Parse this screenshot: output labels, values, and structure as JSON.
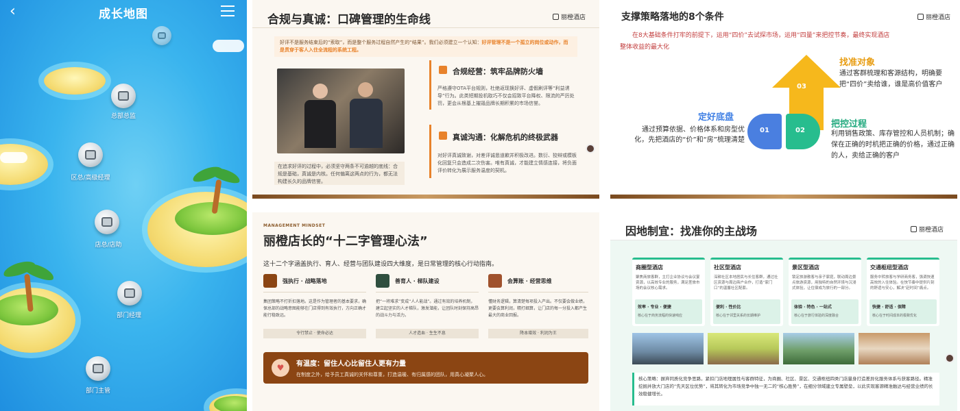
{
  "map": {
    "title": "成长地图",
    "nodes": [
      {
        "label": "总部总监"
      },
      {
        "label": "区总/高级经理"
      },
      {
        "label": "店总/店助"
      },
      {
        "label": "部门经理"
      },
      {
        "label": "部门主管"
      }
    ]
  },
  "slide1": {
    "title": "合规与真诚：口碑管理的生命线",
    "logo": "丽橙酒店",
    "intro_normal": "好评不是服务结束后的“索取”，而是整个服务过程自然产生的“结果”。我们必须建立一个认知：",
    "intro_highlight": "好评管理不是一个孤立的岗位或动作，而是贯穿于客人入住全流程的系统工程。",
    "photo_caption": "在追求好评的过程中，必须坚守两条不可逾越的底线：合规是基础，真诚是内核。任何偏离这两点的行为，都无法构建长久的品牌信誉。",
    "section1_title": "合规经营：筑牢品牌防火墙",
    "section1_text": "严格遵守OTA平台规则，杜绝返现换好评、虚假刷评等“利益诱导”行为。此类短期投机取巧不仅会招致平台降权、限流的严厉处罚，更会从根基上摧毁品牌长期积累的市场信誉。",
    "section2_title": "真诚沟通：化解危机的终极武器",
    "section2_text": "对好评真诚致谢，对差评诚恳道歉并积极改进。数衍、狡辩或模板化回复只会造成二次伤害。唯有真诚，才能建立情感连接，将负面评价转化为展示服务温度的契机。"
  },
  "slide2": {
    "title": "支撑策略落地的8个条件",
    "logo": "丽橙酒店",
    "intro": "在8大基础条件打牢的前提下，运用“四价”去试探市场，运用“四量”来把控节奏，最终实现酒店整体收益的最大化",
    "step1_num": "01",
    "step2_num": "02",
    "step3_num": "03",
    "block1_title": "定好底盘",
    "block1_text": "通过预算依据、价格体系和房型优化，先把酒店的“价”和“房”梳理清楚",
    "block2_title": "把控过程",
    "block2_text": "利用销售政策、库存管控和人员机制；确保在正确的时机把正确的价格，通过正确的人，卖给正确的客户",
    "block3_title": "找准对象",
    "block3_text": "通过客群梳理和客源结构，明确要把“四价”卖给谁，谁是高价值客户",
    "colors": {
      "blue": "#4a7fe0",
      "green": "#27bd8e",
      "yellow": "#f6b81c"
    }
  },
  "slide3": {
    "eyebrow": "MANAGEMENT MINDSET",
    "title": "丽橙店长的“十二字管理心法”",
    "intro": "这十二个字涵盖执行、育人、经营与团队建设四大维度，是日常管理的核心行动指南。",
    "cards": [
      {
        "title": "强执行 · 战略落地",
        "text": "集团策略不打折扣落地。这是作为管理者的基本要求，确保总部的战略意图能够在门店得到有效执行，方向正确才能行稳致远。",
        "tag": "令行禁止 · 使命必达"
      },
      {
        "title": "善育人 · 梯队建设",
        "text": "把“一将难求”变成“人人能战”。通过有效的培养机制，建立起坚实的人才梯队，激发潜能，让团队时刻保持高昂的战斗力与活力。",
        "tag": "人才造血 · 生生不息"
      },
      {
        "title": "会算账 · 经营思维",
        "text": "懂财务逻辑，算清楚每项投入产出。不仅要会做业绩，更要会算利润，精打细算，让门店的每一分投入都产生最大的商业回报。",
        "tag": "降本增效 · 利润为王"
      }
    ],
    "banner_title": "有温度：留住人心比留住人更有力量",
    "banner_text": "在制度之外，给予员工真诚的关怀和尊重，打造温暖、有归属感的团队，用真心凝聚人心。"
  },
  "slide4": {
    "title": "因地制宜：找准你的主战场",
    "logo": "丽橙酒店",
    "columns": [
      {
        "title": "商圈型酒店",
        "text": "聚焦商旅客群，主打企业协议与会议宴资源，以高效专业的服务，满足差旅市场的会议核心需求。",
        "key": "效率 · 专业 · 便捷",
        "sub": "核心在于商务流程的快速响应"
      },
      {
        "title": "社区型酒店",
        "text": "深耕社区本地居民与长住客群，通过社区资源与周边商户合作，打造“家门口”的温馨社区配套。",
        "key": "便利 · 性价比",
        "sub": "核心在于邻里关系的长期维护"
      },
      {
        "title": "景区型酒店",
        "text": "锁定旅游散客与亲子家庭，联动周边景点旅游资源，用独特的自然环境与沉浸式体验，让住宿成为旅行的一部分。",
        "key": "体验 · 特色 · 一站式",
        "sub": "核心在于旅行体验的深度融合"
      },
      {
        "title": "交通枢纽型酒店",
        "text": "服务中转旅客与学研商务客，强调快速高效的入住体验。在快节奏中提供片刻的舒适与安心，解决“赶时间”痛点。",
        "key": "快捷 · 舒适 · 保障",
        "sub": "核心在于时间成本的极致优化"
      }
    ],
    "bottom_text": "核心策略：摒弃同质化竞争思路，紧扣门店地理属性与客群特征，为商圈、社区、景区、交通枢纽四类门店量身打造差异化服务体系与获客路径。精准挖掘并放大门店的“先天区位优势”，将其转化为市场竞争中独一无二的“核心胜势”，在细分领域建立专属壁垒，以此实现客源精准触达与经营业绩的长效稳健增长。"
  }
}
